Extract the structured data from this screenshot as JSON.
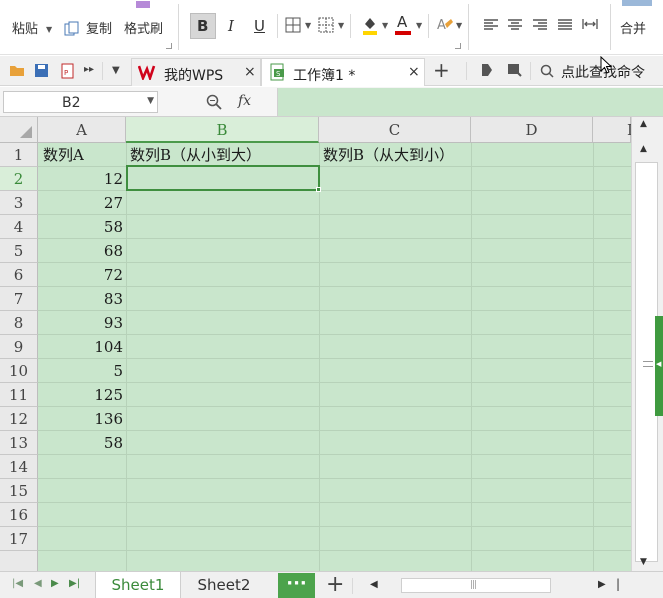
{
  "ribbon": {
    "paste_label": "粘贴",
    "copy_label": "复制",
    "format_painter_label": "格式刷",
    "bold_label": "B",
    "italic_label": "I",
    "underline_label": "U",
    "font_color_letter": "A",
    "merge_label": "合并"
  },
  "tabbar": {
    "tabs": [
      {
        "label": "我的WPS",
        "close": "×",
        "active": false
      },
      {
        "label": "工作簿1 *",
        "close": "×",
        "active": true
      }
    ],
    "add_tab": "+",
    "search_label": "点此查找命令"
  },
  "formula_bar": {
    "name_box": "B2",
    "fx_label": "fx",
    "formula": ""
  },
  "sheet": {
    "columns": [
      "A",
      "B",
      "C",
      "D",
      "I"
    ],
    "selected_column": "B",
    "selected_row": 2,
    "rows": [
      "1",
      "2",
      "3",
      "4",
      "5",
      "6",
      "7",
      "8",
      "9",
      "10",
      "11",
      "12",
      "13",
      "14",
      "15",
      "16",
      "17"
    ],
    "header_row": {
      "a": "数列A",
      "b": "数列B（从小到大）",
      "c": "数列B（从大到小）"
    },
    "column_a_values": [
      "12",
      "27",
      "58",
      "68",
      "72",
      "83",
      "93",
      "104",
      "5",
      "125",
      "136",
      "58"
    ],
    "active_cell": "B2"
  },
  "sheetbar": {
    "sheets": [
      "Sheet1",
      "Sheet2"
    ],
    "active_sheet": "Sheet1",
    "more_label": "···",
    "add_label": "+"
  },
  "colors": {
    "grid_bg": "#c9e6cc",
    "accent_green": "#3f8f3f",
    "header_bg": "#e9e9e9",
    "wps_red": "#d0021b"
  }
}
